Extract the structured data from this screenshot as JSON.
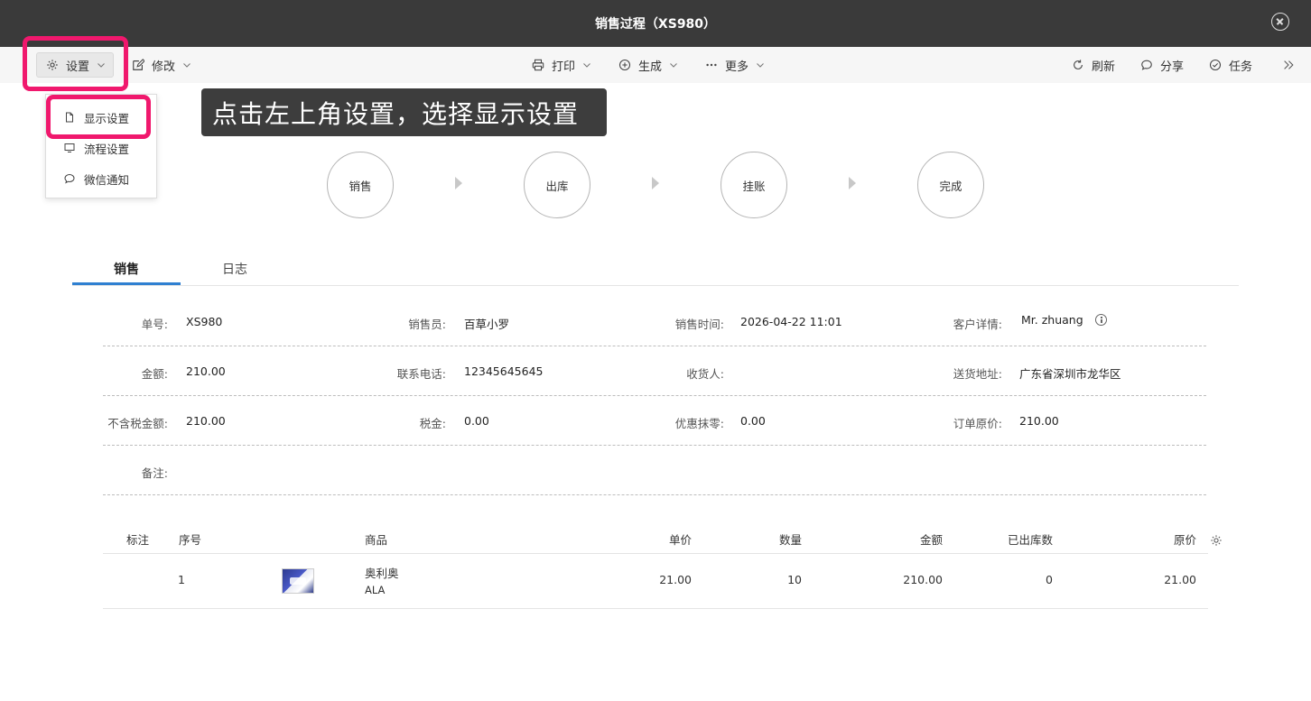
{
  "window": {
    "title": "销售过程（XS980）"
  },
  "toolbar": {
    "settings": "设置",
    "edit": "修改",
    "print": "打印",
    "generate": "生成",
    "more": "更多",
    "refresh": "刷新",
    "share": "分享",
    "task": "任务"
  },
  "settings_menu": {
    "items": [
      {
        "label": "显示设置",
        "icon": "file-icon"
      },
      {
        "label": "流程设置",
        "icon": "monitor-icon"
      },
      {
        "label": "微信通知",
        "icon": "chat-icon"
      }
    ]
  },
  "annotation": {
    "text": "点击左上角设置，选择显示设置"
  },
  "steps": [
    "销售",
    "出库",
    "挂账",
    "完成"
  ],
  "tabs": [
    "销售",
    "日志"
  ],
  "fields": {
    "order_no": {
      "label": "单号:",
      "value": "XS980"
    },
    "salesperson": {
      "label": "销售员:",
      "value": "百草小罗"
    },
    "sale_time": {
      "label": "销售时间:",
      "value": "2026-04-22 11:01"
    },
    "customer": {
      "label": "客户详情:",
      "value": "Mr. zhuang"
    },
    "amount": {
      "label": "金额:",
      "value": "210.00"
    },
    "phone": {
      "label": "联系电话:",
      "value": "12345645645"
    },
    "receiver": {
      "label": "收货人:",
      "value": ""
    },
    "address": {
      "label": "送货地址:",
      "value": "广东省深圳市龙华区"
    },
    "amount_ex_tax": {
      "label": "不含税金额:",
      "value": "210.00"
    },
    "tax": {
      "label": "税金:",
      "value": "0.00"
    },
    "discount": {
      "label": "优惠抹零:",
      "value": "0.00"
    },
    "original_price": {
      "label": "订单原价:",
      "value": "210.00"
    },
    "remark": {
      "label": "备注:",
      "value": ""
    }
  },
  "table": {
    "headers": {
      "mark": "标注",
      "seq": "序号",
      "product": "商品",
      "unit_price": "单价",
      "qty": "数量",
      "amount": "金额",
      "shipped": "已出库数",
      "orig": "原价"
    },
    "rows": [
      {
        "seq": "1",
        "name": "奥利奥",
        "brand": "ALA",
        "unit_price": "21.00",
        "qty": "10",
        "amount": "210.00",
        "shipped": "0",
        "orig": "21.00"
      }
    ]
  },
  "colors": {
    "titlebar": "#3a3a3a",
    "highlight": "#f0186d",
    "tab_active": "#2f80d1"
  }
}
